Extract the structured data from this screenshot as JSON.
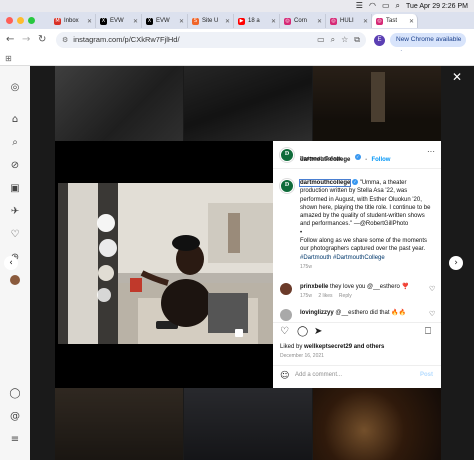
{
  "menubar": {
    "datetime": "Tue Apr 29  2:26 PM"
  },
  "tabs": [
    {
      "label": "Inbox",
      "icon": "gmail-icon",
      "color": "#d93025",
      "glyph": "M"
    },
    {
      "label": "EVW",
      "icon": "x-icon",
      "color": "#000000",
      "glyph": "X"
    },
    {
      "label": "EVW",
      "icon": "x-icon",
      "color": "#000000",
      "glyph": "X"
    },
    {
      "label": "Site U",
      "icon": "site-icon",
      "color": "#f06529",
      "glyph": "S"
    },
    {
      "label": "18 a",
      "icon": "youtube-icon",
      "color": "#ff0000",
      "glyph": "▶"
    },
    {
      "label": "Corn",
      "icon": "instagram-icon",
      "color": "#d62976",
      "glyph": "◎"
    },
    {
      "label": "HULI",
      "icon": "instagram-icon",
      "color": "#d62976",
      "glyph": "◎"
    },
    {
      "label": "Tast",
      "icon": "instagram-icon",
      "color": "#d62976",
      "glyph": "◎"
    }
  ],
  "address": {
    "url": "instagram.com/p/CXkRw7FjlHd/",
    "profile_initial": "E",
    "update_label": "New Chrome available"
  },
  "post": {
    "username": "dartmouthcollege",
    "follow_label": "Follow",
    "location": "Dartmouth College",
    "caption_lines": [
      "\"Umma, a theater",
      "production written by Stella Asa '22, was",
      "performed in August, with Esther Oluokun '20,",
      "shown here, playing the title role. I continue to be",
      "amazed by the quality of student-written shows",
      "and performances.\" —@RobertGillPhoto"
    ],
    "bullet": "•",
    "follow_lines": [
      "Follow along as we share some of the moments",
      "our photographers captured over the past year."
    ],
    "hashtags": "#Dartmouth #DartmouthCollege",
    "caption_age": "175w",
    "comments": [
      {
        "user": "prinxbelle",
        "text": "they love you @__esthero ❣️",
        "age": "175w",
        "likes": "2 likes",
        "reply": "Reply",
        "avatar_color": "#6b3b2a"
      },
      {
        "user": "lovinglizzyy",
        "text": "@__esthero did that 🔥🔥",
        "age": "",
        "likes": "",
        "reply": "",
        "avatar_color": "#a9a9a9"
      }
    ],
    "liked_by_prefix": "Liked by ",
    "liked_by_user": "wellkeptsecret29",
    "liked_by_suffix": " and others",
    "date": "December 16, 2021",
    "comment_placeholder": "Add a comment...",
    "post_label": "Post"
  }
}
